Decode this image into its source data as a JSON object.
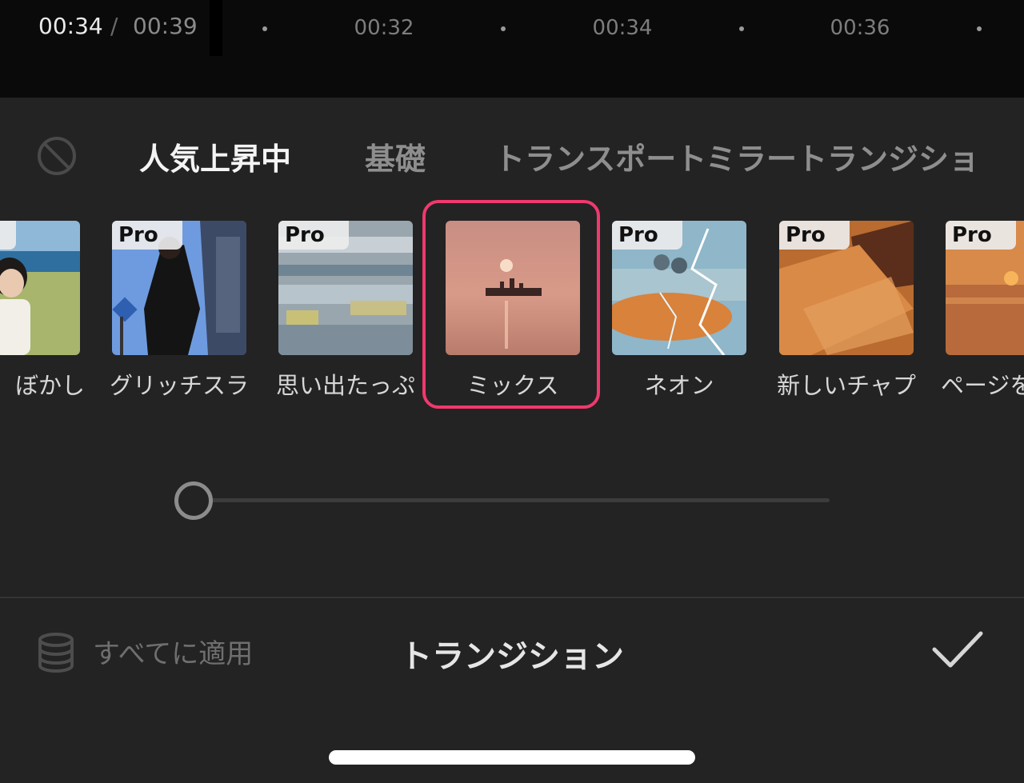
{
  "timeline": {
    "current_time": "00:34",
    "separator": "/",
    "total_time": "00:39",
    "ticks": [
      "00:32",
      "00:34",
      "00:36"
    ]
  },
  "tabs": {
    "none_icon": "prohibited-icon",
    "items": [
      {
        "label": "人気上昇中",
        "active": true
      },
      {
        "label": "基礎",
        "active": false
      },
      {
        "label": "トランスポート",
        "active": false
      },
      {
        "label": "ミラートランジショ",
        "active": false
      }
    ]
  },
  "effects": [
    {
      "label": "ぼかし",
      "pro": true
    },
    {
      "label": "グリッチスラ",
      "pro": true
    },
    {
      "label": "思い出たっぷ",
      "pro": true
    },
    {
      "label": "ミックス",
      "pro": false,
      "selected": true
    },
    {
      "label": "ネオン",
      "pro": true
    },
    {
      "label": "新しいチャプ",
      "pro": true
    },
    {
      "label": "ページを",
      "pro": true
    }
  ],
  "pro_badge": "Pro",
  "slider": {
    "value": 0
  },
  "footer": {
    "apply_all_label": "すべてに適用",
    "apply_all_icon": "database-stack-icon",
    "title": "トランジション",
    "confirm_icon": "checkmark-icon"
  },
  "colors": {
    "accent": "#f0396d",
    "background": "#232323",
    "timeline_bg": "#0a0a0a"
  }
}
